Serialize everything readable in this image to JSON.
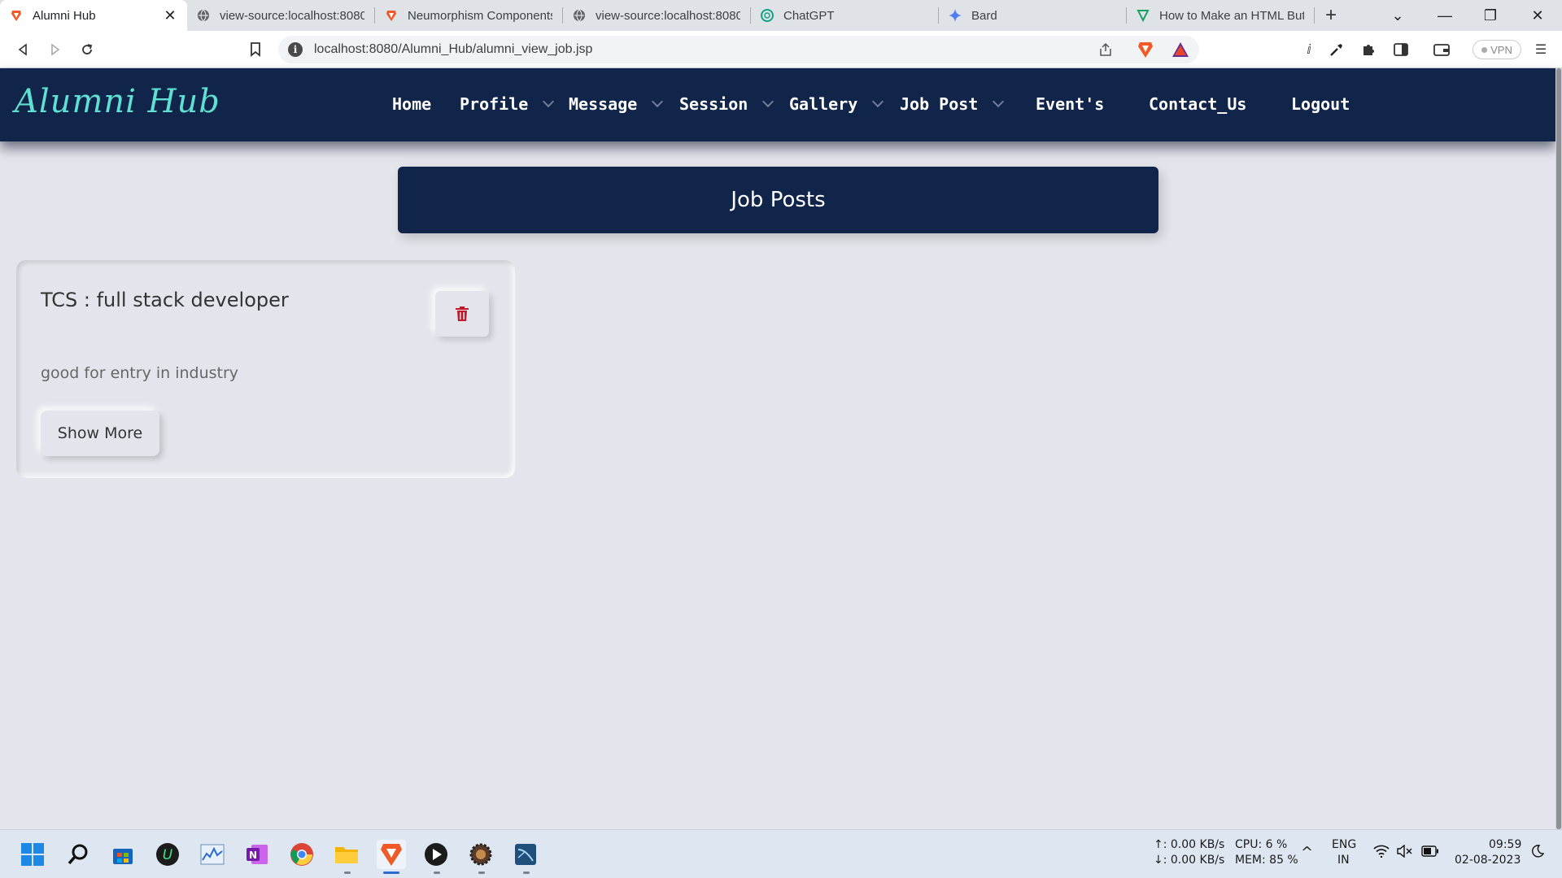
{
  "browser": {
    "tabs": [
      {
        "title": "Alumni Hub",
        "active": true,
        "favicon": "brave-icon"
      },
      {
        "title": "view-source:localhost:8080",
        "active": false,
        "favicon": "globe-icon"
      },
      {
        "title": "Neumorphism Components",
        "active": false,
        "favicon": "brave-icon"
      },
      {
        "title": "view-source:localhost:8080",
        "active": false,
        "favicon": "globe-icon"
      },
      {
        "title": "ChatGPT",
        "active": false,
        "favicon": "chatgpt-icon"
      },
      {
        "title": "Bard",
        "active": false,
        "favicon": "bard-icon"
      },
      {
        "title": "How to Make an HTML Button",
        "active": false,
        "favicon": "leaf-icon"
      }
    ],
    "url": "localhost:8080/Alumni_Hub/alumni_view_job.jsp",
    "vpn_label": "VPN"
  },
  "site": {
    "brand": "Alumni Hub",
    "menu": [
      {
        "label": "Home",
        "dropdown": false
      },
      {
        "label": "Profile",
        "dropdown": true
      },
      {
        "label": "Message",
        "dropdown": true
      },
      {
        "label": "Session",
        "dropdown": true
      },
      {
        "label": "Gallery",
        "dropdown": true
      },
      {
        "label": "Job Post",
        "dropdown": true
      },
      {
        "label": "Event's",
        "dropdown": false
      },
      {
        "label": "Contact_Us",
        "dropdown": false
      },
      {
        "label": "Logout",
        "dropdown": false
      }
    ]
  },
  "main": {
    "heading": "Job Posts",
    "jobs": [
      {
        "title": "TCS : full stack developer",
        "description": "good for entry in industry",
        "show_more_label": "Show More"
      }
    ]
  },
  "taskbar": {
    "net_up": "↑: 0.00 KB/s",
    "net_down": "↓: 0.00 KB/s",
    "cpu": "CPU: 6 %",
    "mem": "MEM: 85 %",
    "lang_top": "ENG",
    "lang_bottom": "IN",
    "time": "09:59",
    "date": "02-08-2023"
  },
  "colors": {
    "navbar": "#11244a",
    "brand": "#5fe0d3",
    "page_bg": "#e4e5ec",
    "delete_icon": "#c0182b"
  }
}
